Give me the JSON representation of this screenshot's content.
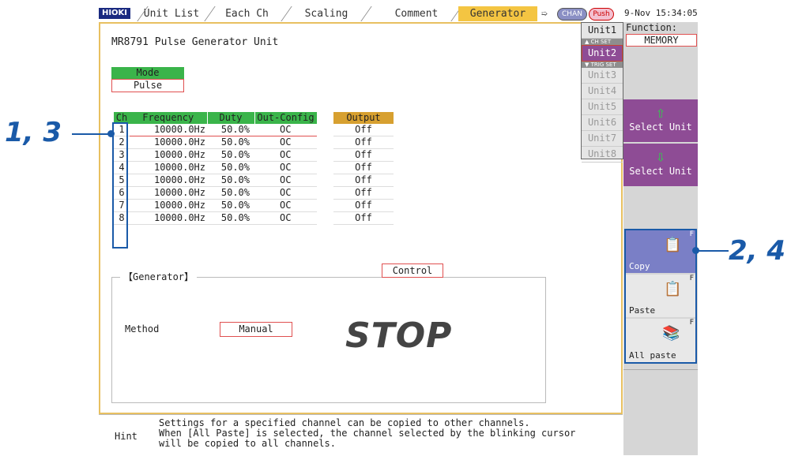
{
  "tabs": {
    "logo": "HIOKI",
    "unit_list": "Unit List",
    "each_ch": "Each Ch",
    "scaling": "Scaling",
    "comment": "Comment",
    "generator": "Generator",
    "chan": "CHAN",
    "push": "Push",
    "datetime": "9-Nov 15:34:05"
  },
  "main": {
    "unit_title": "MR8791 Pulse Generator Unit",
    "mode_label": "Mode",
    "mode_value": "Pulse",
    "table_headers": {
      "ch": "Ch",
      "frequency": "Frequency",
      "duty": "Duty",
      "out_config": "Out-Config",
      "output": "Output"
    },
    "rows": [
      {
        "ch": "1",
        "frequency": "10000.0Hz",
        "duty": "50.0%",
        "out_config": "OC",
        "output": "Off"
      },
      {
        "ch": "2",
        "frequency": "10000.0Hz",
        "duty": "50.0%",
        "out_config": "OC",
        "output": "Off"
      },
      {
        "ch": "3",
        "frequency": "10000.0Hz",
        "duty": "50.0%",
        "out_config": "OC",
        "output": "Off"
      },
      {
        "ch": "4",
        "frequency": "10000.0Hz",
        "duty": "50.0%",
        "out_config": "OC",
        "output": "Off"
      },
      {
        "ch": "5",
        "frequency": "10000.0Hz",
        "duty": "50.0%",
        "out_config": "OC",
        "output": "Off"
      },
      {
        "ch": "6",
        "frequency": "10000.0Hz",
        "duty": "50.0%",
        "out_config": "OC",
        "output": "Off"
      },
      {
        "ch": "7",
        "frequency": "10000.0Hz",
        "duty": "50.0%",
        "out_config": "OC",
        "output": "Off"
      },
      {
        "ch": "8",
        "frequency": "10000.0Hz",
        "duty": "50.0%",
        "out_config": "OC",
        "output": "Off"
      }
    ],
    "generator_label": "【Generator】",
    "control_label": "Control",
    "method_label": "Method",
    "method_value": "Manual",
    "status": "STOP"
  },
  "units": {
    "items": [
      "Unit1",
      "Unit2",
      "Unit3",
      "Unit4",
      "Unit5",
      "Unit6",
      "Unit7",
      "Unit8"
    ],
    "ch_set": "CH SET",
    "trig_set": "TRIG SET"
  },
  "function": {
    "label": "Function:",
    "value": "MEMORY",
    "select_unit_up": "Select Unit",
    "select_unit_down": "Select Unit",
    "copy": "Copy",
    "paste": "Paste",
    "all_paste": "All paste",
    "f_mark": "F"
  },
  "hint": {
    "label": "Hint",
    "line1": "Settings for a specified channel can be copied to other channels.",
    "line2": "When [All Paste] is selected, the channel selected by the blinking cursor",
    "line3": "will be copied to all channels."
  },
  "callouts": {
    "left": "1, 3",
    "right": "2, 4"
  },
  "colors": {
    "accent_header": "#3ab44a",
    "output_header": "#d7a030",
    "tab_active": "#f4c542",
    "select_unit": "#8e4c95",
    "copy_buttons": "#7a7fc6",
    "callout": "#1a5aa8"
  }
}
